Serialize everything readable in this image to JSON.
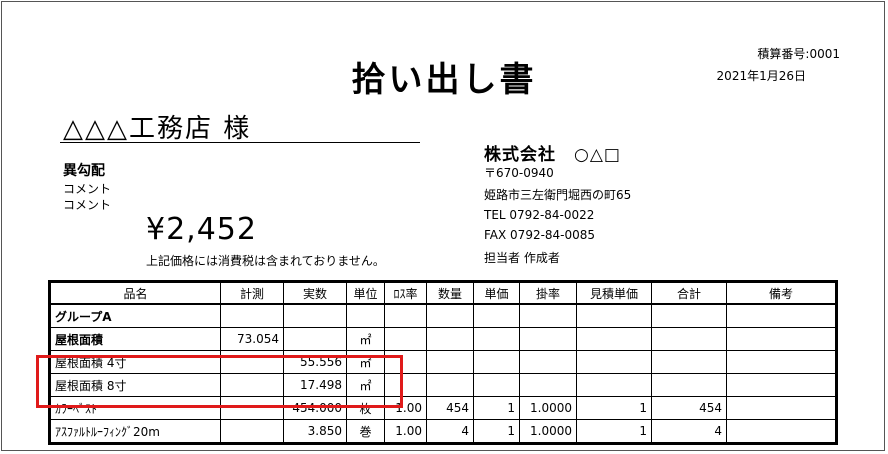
{
  "header": {
    "estimate_no": "積算番号:0001",
    "date": "2021年1月26日",
    "title": "拾い出し書"
  },
  "client": {
    "name": "△△△工務店 様",
    "subject": "異勾配",
    "comment1": "コメント",
    "comment2": "コメント",
    "total": "¥2,452",
    "tax_note": "上記価格には消費税は含まれておりません。"
  },
  "company": {
    "name": "株式会社　○△□",
    "postal": "〒670-0940",
    "address": "姫路市三左衛門堀西の町65",
    "tel": "TEL 0792-84-0022",
    "fax": "FAX 0792-84-0085",
    "person": "担当者 作成者"
  },
  "table": {
    "headers": [
      "品名",
      "計測",
      "実数",
      "単位",
      "ﾛｽ率",
      "数量",
      "単価",
      "掛率",
      "見積単価",
      "合計",
      "備考"
    ],
    "rows": [
      [
        "グループA",
        "",
        "",
        "",
        "",
        "",
        "",
        "",
        "",
        "",
        ""
      ],
      [
        "屋根面積",
        "73.054",
        "",
        "㎡",
        "",
        "",
        "",
        "",
        "",
        "",
        ""
      ],
      [
        "屋根面積 4寸",
        "",
        "55.556",
        "㎡",
        "",
        "",
        "",
        "",
        "",
        "",
        ""
      ],
      [
        "屋根面積 8寸",
        "",
        "17.498",
        "㎡",
        "",
        "",
        "",
        "",
        "",
        "",
        ""
      ],
      [
        "ｶﾗｰﾍﾞｽﾄ",
        "",
        "454.000",
        "枚",
        "1.00",
        "454",
        "1",
        "1.0000",
        "1",
        "454",
        ""
      ],
      [
        "ｱｽﾌｧﾙﾄﾙｰﾌｨﾝｸﾞ20m",
        "",
        "3.850",
        "巻",
        "1.00",
        "4",
        "1",
        "1.0000",
        "1",
        "4",
        ""
      ]
    ]
  },
  "highlight_color": "#e01a1a"
}
